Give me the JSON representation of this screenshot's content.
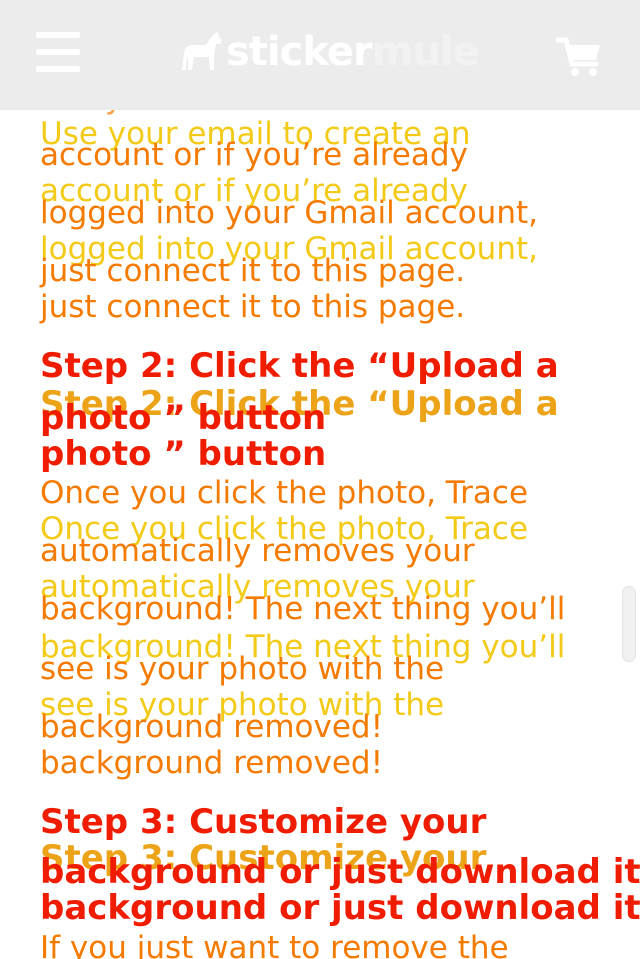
{
  "header": {
    "logo_text_a": "sticker",
    "logo_text_b": "mule",
    "menu_icon": "hamburger-menu-icon",
    "cart_icon": "shopping-cart-icon"
  },
  "colors": {
    "header_bg": "#ececec",
    "body_text": "#f57a00",
    "body_text_ghost": "#f2c500",
    "step_heading": "#ef1c00",
    "step_heading_ghost": "#ea9a00"
  },
  "content": {
    "lines": [
      "Use your email to create an",
      "account or if you’re already",
      "logged into your Gmail account,",
      "just connect it to this page.",
      "Step 2: Click the “Upload a",
      "photo ” button",
      "Once you click the photo, Trace",
      "automatically removes your",
      "background! The next thing you’ll",
      "see is your photo with the",
      "background removed!",
      "Step 3: Customize your",
      "background or just download it",
      "If you just want to remove the"
    ]
  }
}
